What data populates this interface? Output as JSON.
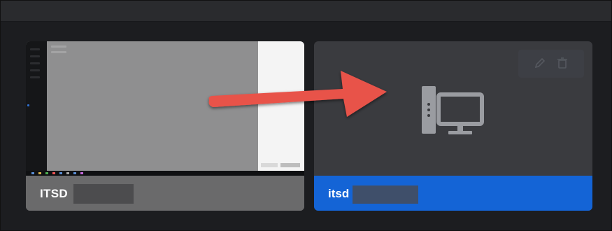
{
  "devices": [
    {
      "name": "ITSD",
      "name_redacted": true,
      "state": "preview",
      "preview_kind": "remote-desktop-screenshot"
    },
    {
      "name": "itsd",
      "name_redacted": true,
      "state": "selected",
      "icon": "desktop-computer-icon",
      "actions": [
        "edit-icon",
        "trash-icon"
      ]
    }
  ],
  "annotation": {
    "kind": "arrow",
    "color": "#e8524a"
  },
  "colors": {
    "background": "#1c1d20",
    "selected_label": "#1464d6",
    "tile_unselected_label": "#6a6a6b"
  }
}
